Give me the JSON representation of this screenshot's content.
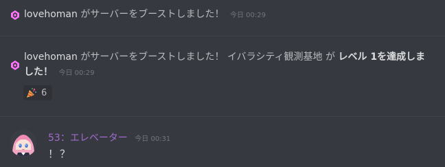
{
  "messages": {
    "boost1": {
      "username": "lovehoman",
      "text": " がサーバーをブーストしました！",
      "timestamp": "今日 00:29",
      "icon": "boost-icon"
    },
    "boost2": {
      "username": "lovehoman",
      "text_a": " がサーバーをブーストしました！ イバラシティ観測基地 が ",
      "text_bold": "レベル 1を達成しました！",
      "timestamp": "今日 00:29",
      "icon": "boost-icon",
      "reaction": {
        "emoji": "party-popper-icon",
        "count": "6"
      }
    },
    "chat": {
      "author": "53：エレベーター",
      "timestamp": "今日 00:31",
      "body": "！？",
      "author_color": "#a16bcf"
    }
  },
  "colors": {
    "background": "#36393f",
    "boost_pink": "#ff73fa",
    "divider": "#40434a"
  }
}
